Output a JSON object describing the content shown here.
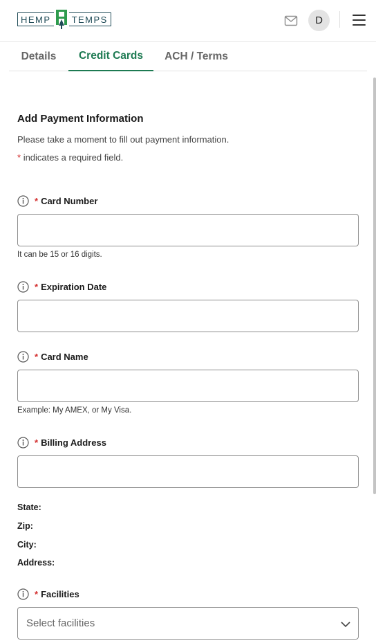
{
  "header": {
    "logo_left": "HEMP",
    "logo_right": "TEMPS",
    "avatar_initial": "D"
  },
  "tabs": [
    {
      "label": "Details",
      "active": false
    },
    {
      "label": "Credit Cards",
      "active": true
    },
    {
      "label": "ACH / Terms",
      "active": false
    }
  ],
  "form": {
    "title": "Add Payment Information",
    "subtitle": "Please take a moment to fill out payment information.",
    "required_star": "*",
    "required_note": "indicates a required field.",
    "card_number": {
      "label": "Card Number",
      "value": "",
      "hint": "It can be 15 or 16 digits."
    },
    "expiration_date": {
      "label": "Expiration Date",
      "value": ""
    },
    "card_name": {
      "label": "Card Name",
      "value": "",
      "hint": "Example: My AMEX, or My Visa."
    },
    "billing_address": {
      "label": "Billing Address",
      "value": ""
    },
    "address_details": {
      "state": "State:",
      "zip": "Zip:",
      "city": "City:",
      "address": "Address:"
    },
    "facilities": {
      "label": "Facilities",
      "placeholder": "Select facilities"
    }
  },
  "colors": {
    "accent": "#1d7a52",
    "required": "#d32f2f",
    "logo": "#1f4b57"
  },
  "icons": [
    "mail-icon",
    "hamburger-menu-icon",
    "info-icon",
    "chevron-down-icon"
  ]
}
